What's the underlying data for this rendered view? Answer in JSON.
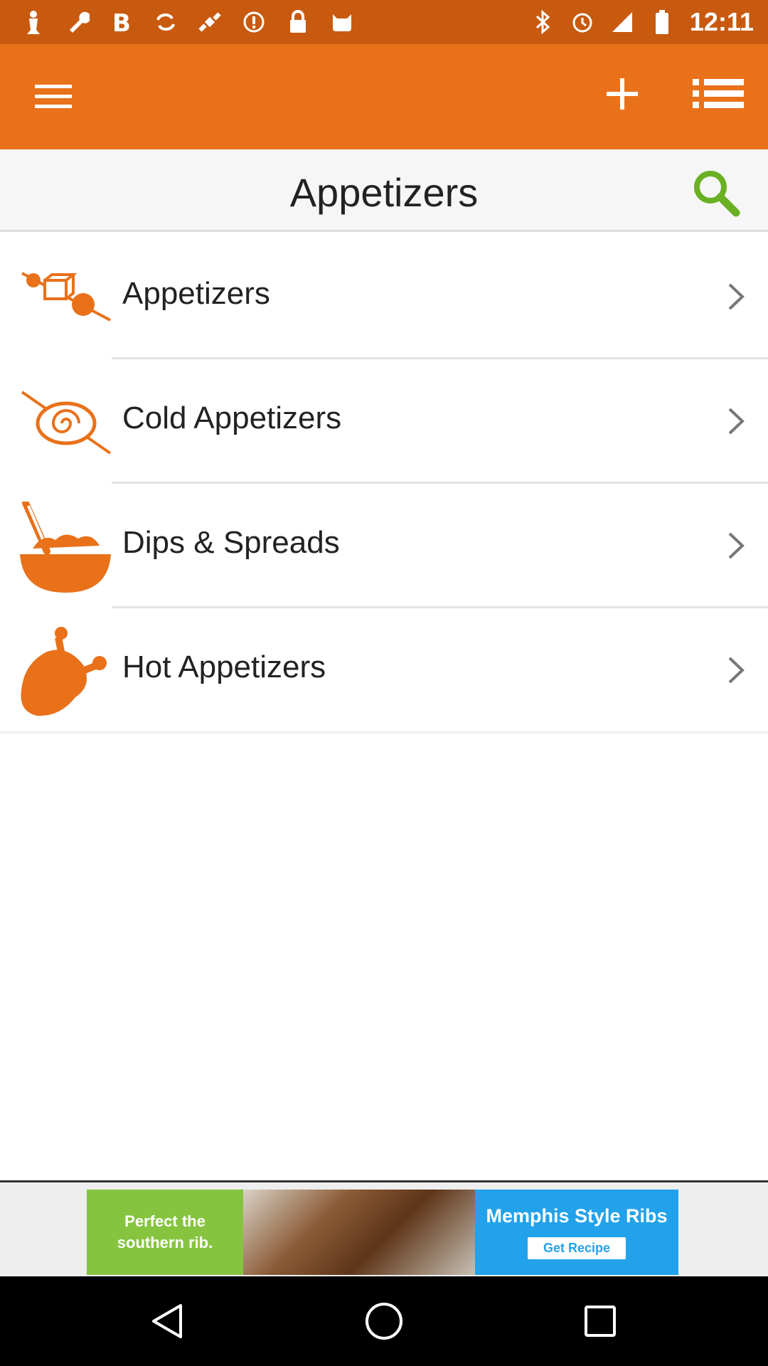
{
  "status_bar": {
    "time": "12:11",
    "left_icons": [
      "chess-icon",
      "wrench-icon",
      "bold-b-icon",
      "sync-icon",
      "satellite-icon",
      "alert-icon",
      "lock-icon",
      "cat-icon"
    ],
    "right_icons": [
      "bluetooth-icon",
      "alarm-icon",
      "signal-icon",
      "battery-icon"
    ]
  },
  "app_bar": {
    "color": "#e8711a",
    "menu_icon": "hamburger-menu-icon",
    "add_icon": "plus-icon",
    "list_icon": "list-view-icon"
  },
  "header": {
    "title": "Appetizers",
    "search_icon": "search-icon",
    "search_color": "#6ab023"
  },
  "categories": [
    {
      "label": "Appetizers",
      "icon": "skewer-icon"
    },
    {
      "label": "Cold Appetizers",
      "icon": "roll-skewer-icon"
    },
    {
      "label": "Dips & Spreads",
      "icon": "dip-bowl-icon"
    },
    {
      "label": "Hot Appetizers",
      "icon": "chicken-leg-icon"
    }
  ],
  "ad": {
    "left_text": "Perfect the southern rib.",
    "headline": "Memphis Style Ribs",
    "cta": "Get Recipe"
  },
  "nav_bar": {
    "back_icon": "back-triangle-icon",
    "home_icon": "home-circle-icon",
    "recents_icon": "recents-square-icon"
  }
}
